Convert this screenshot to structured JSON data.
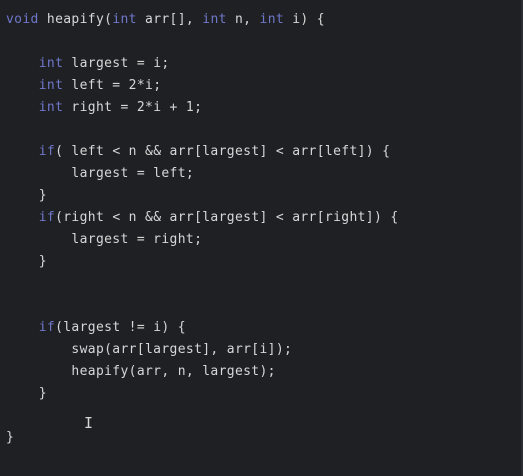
{
  "editor": {
    "theme_colors": {
      "background": "#1f2024",
      "text": "#d7d7d7",
      "keyword": "#6f77c9"
    },
    "lines": [
      [
        {
          "text": "void",
          "kind": "keyword"
        },
        {
          "text": " heapify(",
          "kind": "text"
        },
        {
          "text": "int",
          "kind": "keyword"
        },
        {
          "text": " arr[], ",
          "kind": "text"
        },
        {
          "text": "int",
          "kind": "keyword"
        },
        {
          "text": " n, ",
          "kind": "text"
        },
        {
          "text": "int",
          "kind": "keyword"
        },
        {
          "text": " i) {",
          "kind": "text"
        }
      ],
      [],
      [
        {
          "text": "    ",
          "kind": "text"
        },
        {
          "text": "int",
          "kind": "keyword"
        },
        {
          "text": " largest = i;",
          "kind": "text"
        }
      ],
      [
        {
          "text": "    ",
          "kind": "text"
        },
        {
          "text": "int",
          "kind": "keyword"
        },
        {
          "text": " left = 2*i;",
          "kind": "text"
        }
      ],
      [
        {
          "text": "    ",
          "kind": "text"
        },
        {
          "text": "int",
          "kind": "keyword"
        },
        {
          "text": " right = 2*i + 1;",
          "kind": "text"
        }
      ],
      [],
      [
        {
          "text": "    ",
          "kind": "text"
        },
        {
          "text": "if",
          "kind": "keyword"
        },
        {
          "text": "( left < n && arr[largest] < arr[left]) {",
          "kind": "text"
        }
      ],
      [
        {
          "text": "        largest = left;",
          "kind": "text"
        }
      ],
      [
        {
          "text": "    }",
          "kind": "text"
        }
      ],
      [
        {
          "text": "    ",
          "kind": "text"
        },
        {
          "text": "if",
          "kind": "keyword"
        },
        {
          "text": "(right < n && arr[largest] < arr[right]) {",
          "kind": "text"
        }
      ],
      [
        {
          "text": "        largest = right;",
          "kind": "text"
        }
      ],
      [
        {
          "text": "    }",
          "kind": "text"
        }
      ],
      [],
      [],
      [
        {
          "text": "    ",
          "kind": "text"
        },
        {
          "text": "if",
          "kind": "keyword"
        },
        {
          "text": "(largest != i) {",
          "kind": "text"
        }
      ],
      [
        {
          "text": "        swap(arr[largest], arr[i]);",
          "kind": "text"
        }
      ],
      [
        {
          "text": "        heapify(arr, n, largest);",
          "kind": "text"
        }
      ],
      [
        {
          "text": "    }",
          "kind": "text"
        }
      ],
      [],
      [
        {
          "text": "}",
          "kind": "text"
        }
      ]
    ],
    "text_cursor_glyph": "I"
  }
}
